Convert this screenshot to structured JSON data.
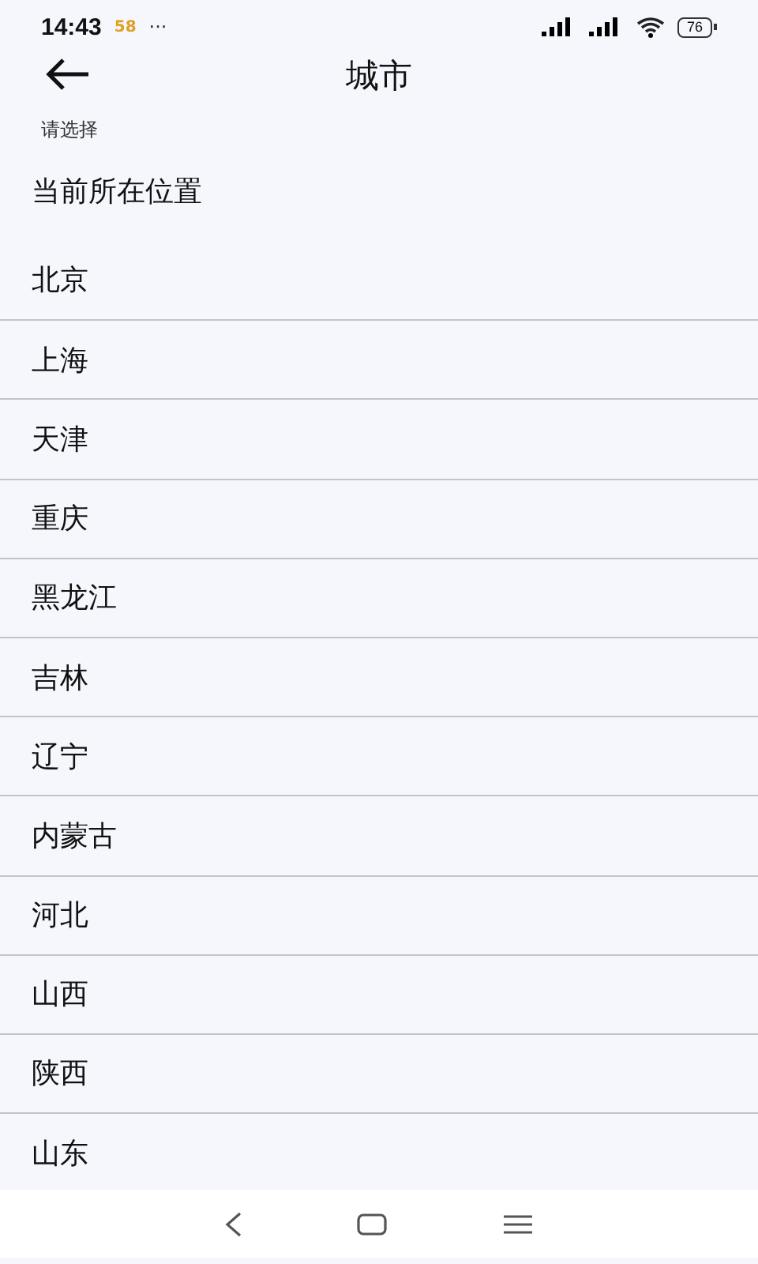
{
  "status_bar": {
    "time": "14:43",
    "notification": "58",
    "more": "···",
    "battery": "76"
  },
  "header": {
    "title": "城市"
  },
  "section_label": "请选择",
  "current_location": "当前所在位置",
  "cities": [
    "北京",
    "上海",
    "天津",
    "重庆",
    "黑龙江",
    "吉林",
    "辽宁",
    "内蒙古",
    "河北",
    "山西",
    "陕西",
    "山东"
  ]
}
